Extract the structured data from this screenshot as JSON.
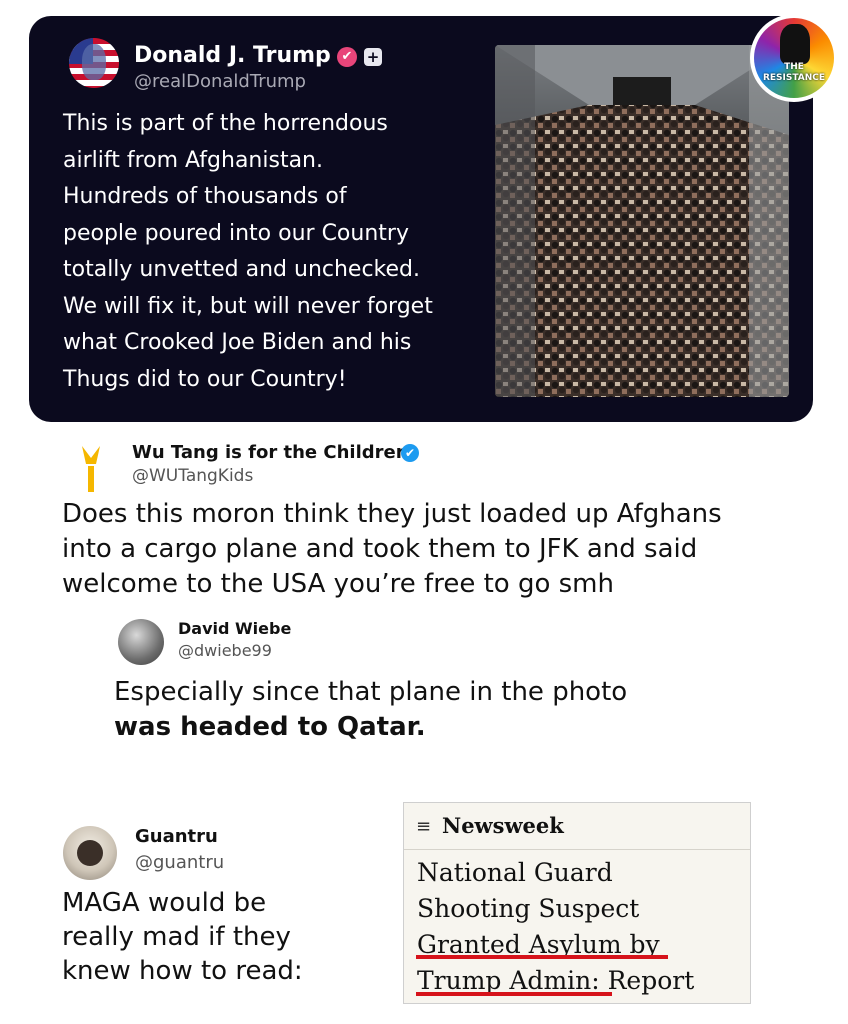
{
  "trump_post": {
    "name": "Donald J. Trump",
    "handle": "@realDonaldTrump",
    "badge_verified": "✔",
    "badge_plus": "+",
    "lines": [
      "This is part of the horrendous",
      "airlift from Afghanistan.",
      "Hundreds of thousands of",
      "people poured into our Country",
      "totally unvetted and unchecked.",
      "We will fix it, but will never forget",
      "what Crooked Joe Biden and his",
      "Thugs did to our Country!"
    ],
    "photo_icon": "crowded-cargo-plane-photo"
  },
  "watermark": {
    "line1": "THE",
    "line2": "RESISTANCE"
  },
  "wu_post": {
    "name": "Wu Tang is for the Children",
    "handle": "@WUTangKids",
    "badge_verified": "✔",
    "lines": [
      "Does this moron think they just loaded up Afghans",
      "into a cargo plane and took them to JFK and said",
      "welcome to the USA you’re free to go smh"
    ]
  },
  "dw_post": {
    "name": "David Wiebe",
    "handle": "@dwiebe99",
    "line1": "Especially since that plane in the photo",
    "line2_bold": "was headed to Qatar."
  },
  "gu_post": {
    "name": "Guantru",
    "handle": "@guantru",
    "lines": [
      "MAGA would be",
      "really mad if they",
      "knew how to read:"
    ]
  },
  "newsweek": {
    "menu_icon": "≡",
    "brand": "Newsweek",
    "headline_lines": [
      "National Guard",
      "Shooting Suspect",
      "Granted Asylum by",
      "Trump Admin: Report"
    ],
    "underline_color": "#d6131b"
  },
  "colors": {
    "dark_card": "#0b0a1e",
    "verified_pink": "#e8457a",
    "verified_blue": "#1d9bf0"
  }
}
